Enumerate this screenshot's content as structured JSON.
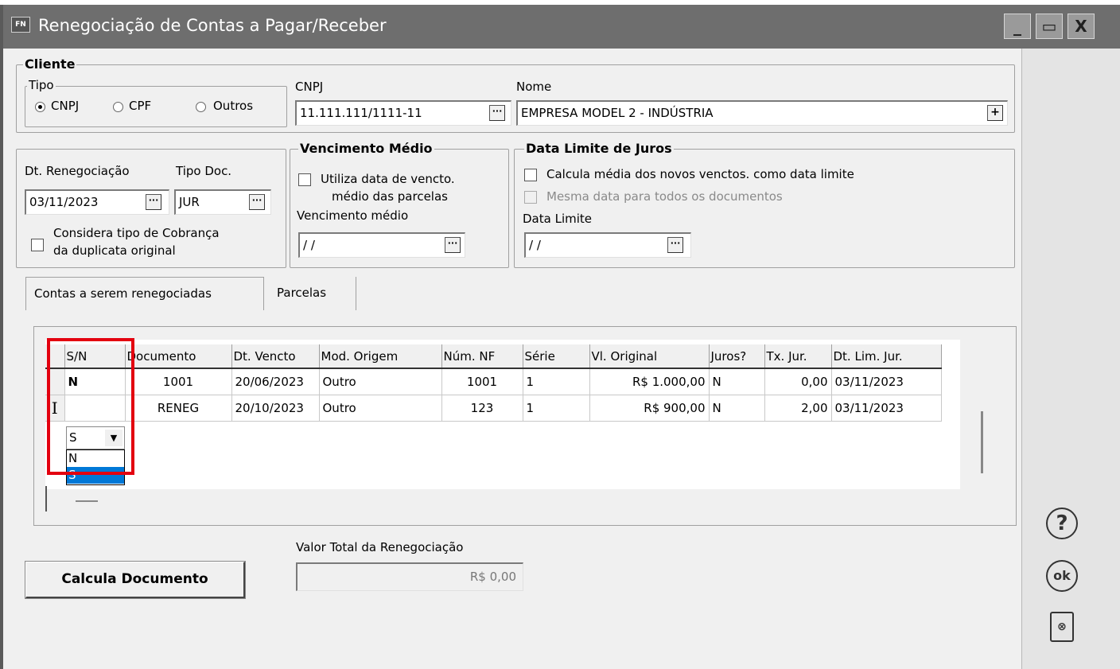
{
  "window": {
    "title": "Renegociação de Contas a Pagar/Receber",
    "app_badge": "FN"
  },
  "cliente": {
    "title": "Cliente",
    "tipo": {
      "title": "Tipo",
      "options": [
        "CNPJ",
        "CPF",
        "Outros"
      ],
      "selected": "CNPJ"
    },
    "cnpj": {
      "label": "CNPJ",
      "value": "11.111.111/1111-11"
    },
    "nome": {
      "label": "Nome",
      "value": "EMPRESA MODEL 2 - INDÚSTRIA"
    }
  },
  "renegociacao": {
    "dt_label": "Dt. Renegociação",
    "dt_value": "03/11/2023",
    "tipo_doc_label": "Tipo Doc.",
    "tipo_doc_value": "JUR",
    "considera_line1": "Considera tipo de Cobrança",
    "considera_line2": "da duplicata original"
  },
  "vencimento_medio": {
    "title": "Vencimento Médio",
    "check_line1": "Utiliza data de vencto.",
    "check_line2": "médio das parcelas",
    "label": "Vencimento médio",
    "value": " / /"
  },
  "data_limite_juros": {
    "title": "Data Limite de Juros",
    "check1": "Calcula média dos novos venctos. como data limite",
    "check2": "Mesma data para todos os documentos",
    "label": "Data Limite",
    "value": " / /"
  },
  "tabs": {
    "tab1": "Contas a serem renegociadas",
    "tab2": "Parcelas"
  },
  "grid": {
    "columns": [
      "S/N",
      "Documento",
      "Dt. Vencto",
      "Mod. Origem",
      "Núm. NF",
      "Série",
      "Vl. Original",
      "Juros?",
      "Tx. Jur.",
      "Dt. Lim. Jur."
    ],
    "rows": [
      {
        "sn": "N",
        "documento": "1001",
        "dt_vencto": "20/06/2023",
        "mod_origem": "Outro",
        "num_nf": "1001",
        "serie": "1",
        "vl_original": "R$ 1.000,00",
        "juros": "N",
        "tx_jur": "0,00",
        "dt_lim_jur": "03/11/2023"
      },
      {
        "sn": "S",
        "documento": "RENEG",
        "dt_vencto": "20/10/2023",
        "mod_origem": "Outro",
        "num_nf": "123",
        "serie": "1",
        "vl_original": "R$ 900,00",
        "juros": "N",
        "tx_jur": "2,00",
        "dt_lim_jur": "03/11/2023"
      }
    ],
    "row_cursor": "I",
    "dropdown_options": [
      "N",
      "S"
    ],
    "dropdown_selected": "S"
  },
  "valor_total": {
    "label": "Valor Total da Renegociação",
    "value": "R$ 0,00"
  },
  "buttons": {
    "calcula": "Calcula Documento",
    "help": "?",
    "ok": "ok",
    "doc": "⊗",
    "min": "_",
    "max": "▭",
    "close": "X",
    "dots": "···",
    "plus": "+",
    "arrow": "▼"
  },
  "colors": {
    "titlebar": "#6e6e6e",
    "highlight": "#e3000f",
    "selection": "#0078d7"
  }
}
